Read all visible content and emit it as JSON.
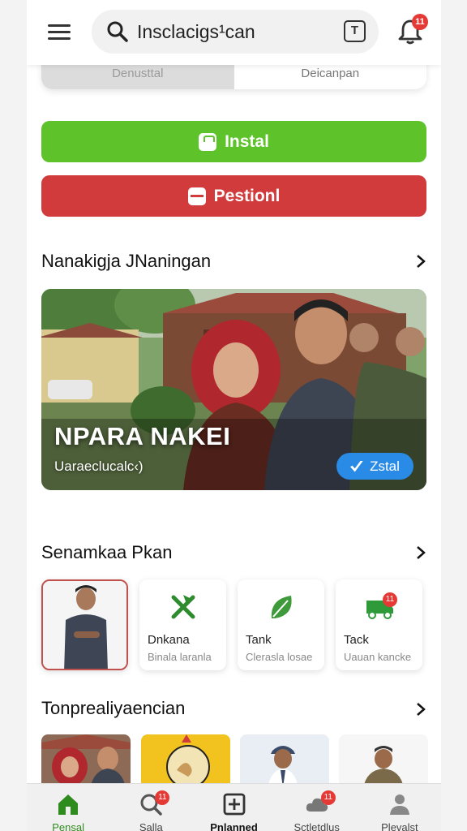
{
  "header": {
    "search_text": "Insclacigs¹can",
    "tool_icon_label": "T",
    "notification_count": "11"
  },
  "segments": [
    {
      "label": "Denusttal",
      "active": true
    },
    {
      "label": "Deicanpan",
      "active": false
    }
  ],
  "actions": {
    "install_label": "Instal",
    "position_label": "Pestionl"
  },
  "section1": {
    "title": "Nanakigja JNaningan"
  },
  "hero": {
    "title": "NPARA NAKEI",
    "subtitle": "Uaraeclucalc‹)",
    "pill_label": "Zstal"
  },
  "section2": {
    "title": "Senamkaa Pkan"
  },
  "cards": [
    {
      "type": "photo",
      "selected": true
    },
    {
      "title": "Dnkana",
      "subtitle": "Binala laranla",
      "icon": "pickaxe-icon"
    },
    {
      "title": "Tank",
      "subtitle": "Clerasla losae",
      "icon": "leaf-icon"
    },
    {
      "title": "Tack",
      "subtitle": "Uauan kancke",
      "icon": "truck-icon",
      "badge": "11"
    }
  ],
  "section3": {
    "title": "Tonprealiyaencian"
  },
  "bottom_nav": [
    {
      "label": "Pensal",
      "icon": "home-icon",
      "active": true
    },
    {
      "label": "Salla",
      "icon": "search-icon",
      "badge": "11"
    },
    {
      "label": "Pnlanned",
      "icon": "add-square-icon"
    },
    {
      "label": "Sctletdlus",
      "icon": "cloud-icon",
      "badge": "11"
    },
    {
      "label": "Plevalst",
      "icon": "profile-icon"
    }
  ],
  "colors": {
    "install_green": "#5ec22a",
    "position_red": "#d23b3b",
    "accent_blue": "#2a8be6",
    "active_nav_green": "#2e8b1e",
    "badge_red": "#e53935"
  }
}
